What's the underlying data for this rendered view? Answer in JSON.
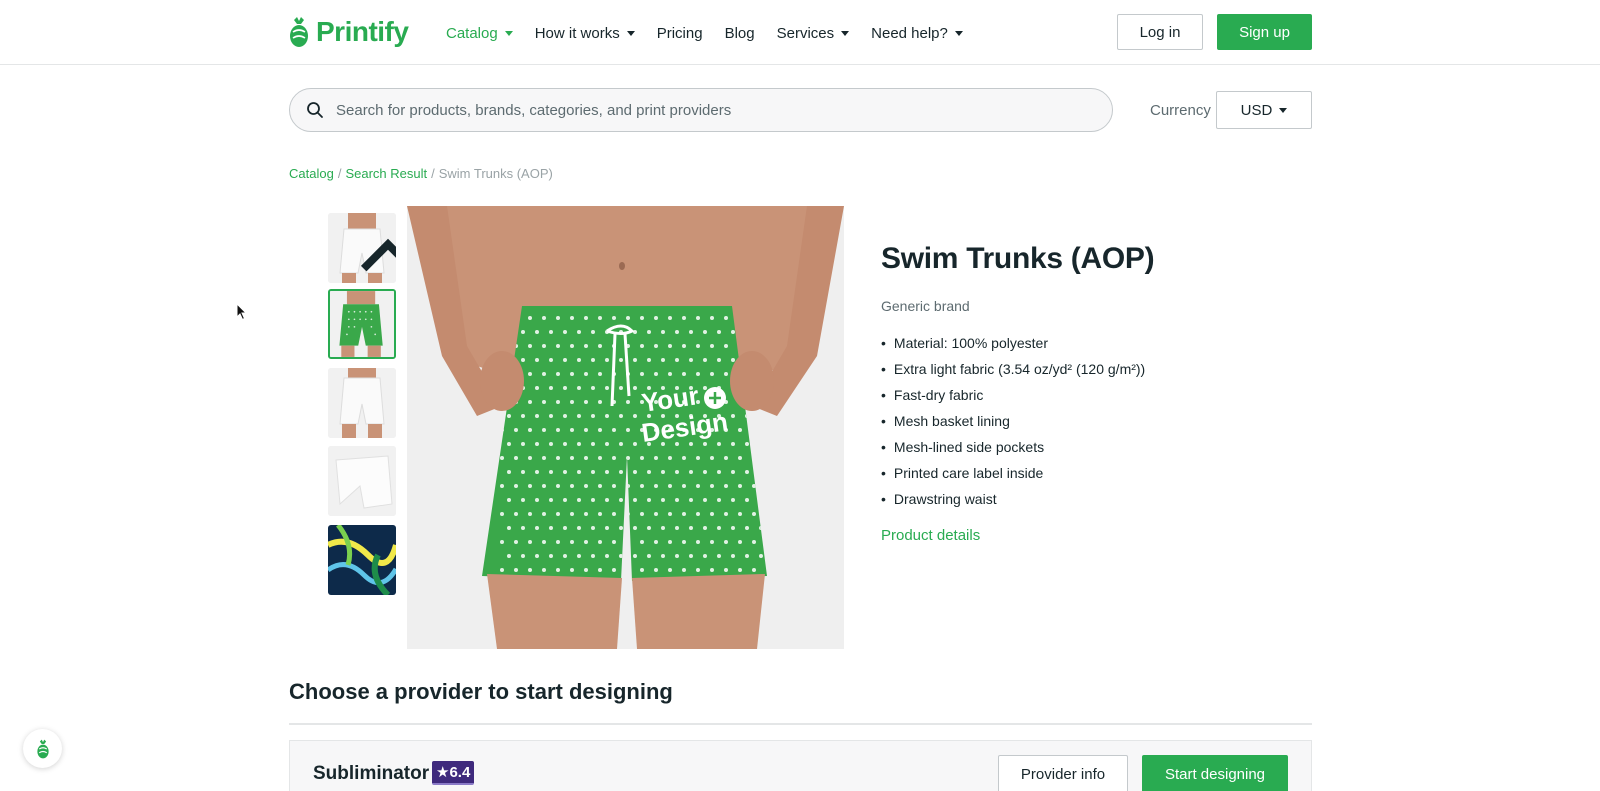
{
  "brand": {
    "logo_text": "Printify",
    "accent_color": "#29ab51"
  },
  "nav": {
    "items": [
      {
        "label": "Catalog",
        "dropdown": true,
        "active": true
      },
      {
        "label": "How it works",
        "dropdown": true,
        "active": false
      },
      {
        "label": "Pricing",
        "dropdown": false,
        "active": false
      },
      {
        "label": "Blog",
        "dropdown": false,
        "active": false
      },
      {
        "label": "Services",
        "dropdown": true,
        "active": false
      },
      {
        "label": "Need help?",
        "dropdown": true,
        "active": false
      }
    ],
    "login_label": "Log in",
    "signup_label": "Sign up"
  },
  "search": {
    "placeholder": "Search for products, brands, categories, and print providers",
    "value": ""
  },
  "currency": {
    "label": "Currency",
    "selected": "USD"
  },
  "breadcrumb": {
    "items": [
      "Catalog",
      "Search Result"
    ],
    "current": "Swim Trunks (AOP)",
    "separator": "/"
  },
  "product": {
    "title": "Swim Trunks (AOP)",
    "brand": "Generic brand",
    "features": [
      "Material: 100% polyester",
      "Extra light fabric (3.54 oz/yd² (120 g/m²))",
      "Fast-dry fabric",
      "Mesh basket lining",
      "Mesh-lined side pockets",
      "Printed care label inside",
      "Drawstring waist"
    ],
    "details_link": "Product details",
    "image_overlay_text": [
      "Your",
      "Design"
    ],
    "selected_thumbnail": 1
  },
  "providers": {
    "section_title": "Choose a provider to start designing",
    "first": {
      "name": "Subliminator",
      "rating": "★6.4",
      "info_label": "Provider info",
      "start_label": "Start designing"
    }
  },
  "icons": {
    "search": "search-icon",
    "caret": "caret-down-icon",
    "thumb_scroll_up": "chevron-up-icon",
    "chat": "chat-logo-icon"
  }
}
